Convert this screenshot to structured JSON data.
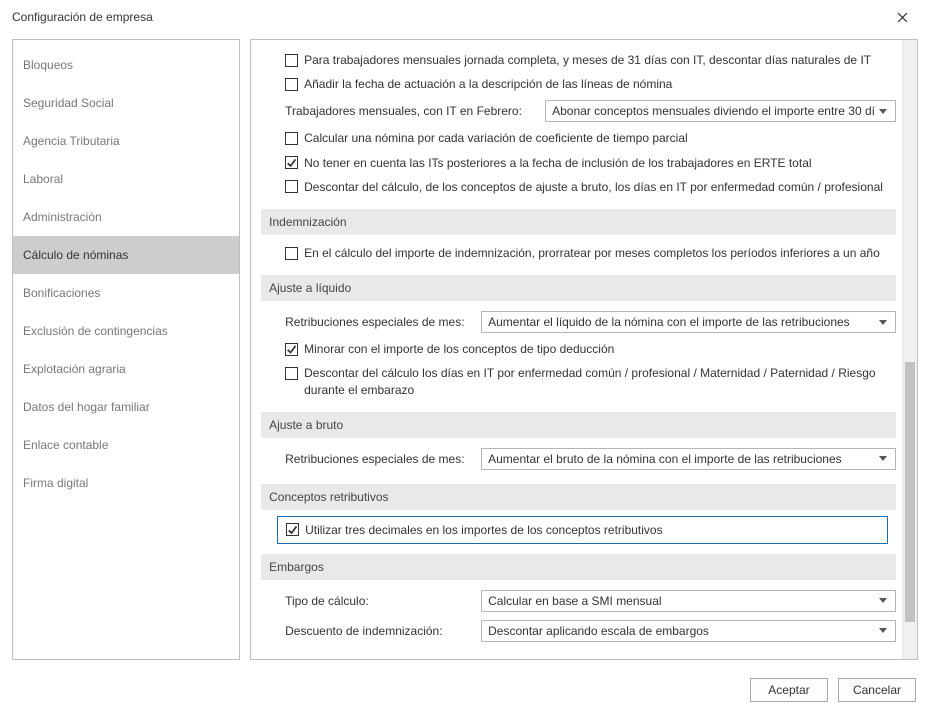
{
  "window": {
    "title": "Configuración de empresa"
  },
  "sidebar": {
    "items": [
      {
        "label": "Bloqueos"
      },
      {
        "label": "Seguridad Social"
      },
      {
        "label": "Agencia Tributaria"
      },
      {
        "label": "Laboral"
      },
      {
        "label": "Administración"
      },
      {
        "label": "Cálculo de nóminas",
        "selected": true
      },
      {
        "label": "Bonificaciones"
      },
      {
        "label": "Exclusión de contingencias"
      },
      {
        "label": "Explotación agraria"
      },
      {
        "label": "Datos del hogar familiar"
      },
      {
        "label": "Enlace contable"
      },
      {
        "label": "Firma digital"
      }
    ]
  },
  "top_checks": [
    {
      "label": "Para trabajadores mensuales jornada completa, y meses de 31 días con IT, descontar días naturales de IT",
      "checked": false
    },
    {
      "label": "Añadir la fecha de actuación a la descripción de las líneas de nómina",
      "checked": false
    }
  ],
  "top_field": {
    "label": "Trabajadores mensuales, con IT en Febrero:",
    "value": "Abonar conceptos mensuales diviendo el importe entre 30 dí"
  },
  "top_checks2": [
    {
      "label": "Calcular una nómina por cada variación de coeficiente de tiempo parcial",
      "checked": false
    },
    {
      "label": "No tener en cuenta las ITs posteriores a la fecha de inclusión de los trabajadores en ERTE total",
      "checked": true
    },
    {
      "label": "Descontar del cálculo, de los conceptos de ajuste a bruto, los días en IT por enfermedad común / profesional",
      "checked": false
    }
  ],
  "indemnizacion": {
    "title": "Indemnización",
    "check": {
      "label": "En el cálculo del importe de indemnización, prorratear por meses completos los períodos inferiores a un año",
      "checked": false
    }
  },
  "ajuste_liquido": {
    "title": "Ajuste a líquido",
    "select_label": "Retribuciones especiales de mes:",
    "select_value": "Aumentar el líquido de la nómina con el importe de las retribuciones",
    "checks": [
      {
        "label": "Minorar con el importe de los conceptos de tipo deducción",
        "checked": true
      },
      {
        "label": "Descontar del cálculo los días en IT por enfermedad común / profesional / Maternidad / Paternidad / Riesgo durante el embarazo",
        "checked": false
      }
    ]
  },
  "ajuste_bruto": {
    "title": "Ajuste a bruto",
    "select_label": "Retribuciones especiales de mes:",
    "select_value": "Aumentar el bruto de la nómina con el importe de las retribuciones"
  },
  "conceptos": {
    "title": "Conceptos retributivos",
    "highlight": {
      "label": "Utilizar tres decimales en los importes de los conceptos retributivos",
      "checked": true
    }
  },
  "embargos": {
    "title": "Embargos",
    "fields": [
      {
        "label": "Tipo de cálculo:",
        "value": "Calcular en base a SMI mensual"
      },
      {
        "label": "Descuento de indemnización:",
        "value": "Descontar aplicando escala de embargos"
      }
    ]
  },
  "footer": {
    "accept": "Aceptar",
    "cancel": "Cancelar"
  }
}
